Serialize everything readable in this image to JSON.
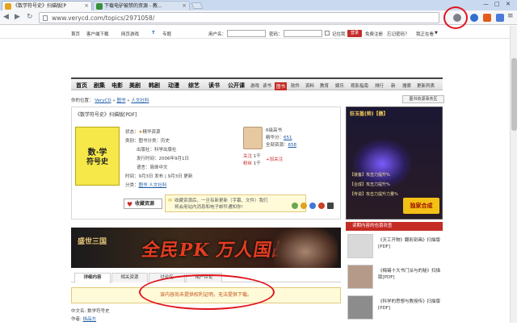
{
  "browser": {
    "tabs": [
      {
        "title": "《数学符号史》扫描版[P",
        "active": true
      },
      {
        "title": "下载电驴被禁的资源 - 教...",
        "active": false
      }
    ],
    "url": "www.verycd.com/topics/2971058/",
    "window_controls": [
      "—",
      "□",
      "✕"
    ]
  },
  "topbar": {
    "links": [
      "首页",
      "客户端下载",
      "网页游戏",
      "T",
      "专题"
    ],
    "username_label": "用户名：",
    "password_label": "密码：",
    "remember": "记住我",
    "login": "登录",
    "register": "免费注册",
    "forgot": "忘记密码？",
    "want": "我正在看"
  },
  "mainnav": {
    "big": [
      "首页",
      "剧集",
      "电影",
      "美剧",
      "韩剧",
      "动漫",
      "综艺",
      "读书",
      "公开课"
    ],
    "small": [
      "游戏",
      "读书",
      "图书",
      "软件",
      "资料",
      "教育",
      "娱乐",
      "观影指南",
      "排行",
      "新",
      "搜索",
      "更新列表"
    ]
  },
  "breadcrumb": {
    "prefix": "你的位置：",
    "items": [
      "VeryCD",
      "图书",
      "人文社科"
    ],
    "sep": "»",
    "top_button": "图书资源事务区"
  },
  "item": {
    "title": "《数学符号史》扫描版[PDF]",
    "cover_title": "数·学",
    "cover_subtitle": "符号史",
    "meta": [
      {
        "k": "状态：",
        "v": "精华资源"
      },
      {
        "k": "类别：",
        "v": "图书分类：历史"
      },
      {
        "k": "",
        "v": "出版社：科学出版社"
      },
      {
        "k": "",
        "v": "发行时间：2006年9月1日"
      },
      {
        "k": "",
        "v": "语言：简体中文"
      },
      {
        "k": "时间：",
        "v": "9月3日 发布 | 9月3日 更新"
      },
      {
        "k": "分类：",
        "v": "图书  人文社科"
      }
    ],
    "uploader": {
      "name": "6级高书",
      "uploads_label": "精华分：",
      "uploads": "651",
      "total_label": "全部资源：",
      "total": "658",
      "follow_label": "关注",
      "follow_count": "1千",
      "fans_label": "粉丝",
      "fans_count": "1千",
      "add_follow": "加关注"
    },
    "favorite_button": "收藏资源",
    "tooltip_line1": "收藏资源后，一旦有新更新（字幕、文件）我们",
    "tooltip_line2": "将会用站内消息和电子邮件通知你!"
  },
  "game_ad": {
    "name": "狂玉盔(帅)",
    "tag": "傲",
    "lines": [
      "【装备】攻击力提升%",
      "【合成】攻击力提升%",
      "【传说】攻击力提升力量%"
    ],
    "button": "独家合成"
  },
  "banner": {
    "logo": "盛世三国",
    "slogan": "全民PK 万人国战"
  },
  "related": {
    "header": "读期内容的也喜欢查",
    "items": [
      {
        "text": "《天工开物》翻彩刻画》扫描版[PDF]",
        "thumb_color": "#d9d9d9"
      },
      {
        "text": "《梅锡十大书门派与的秘》扫描版[PDF]",
        "thumb_color": "#b59a8a"
      },
      {
        "text": "《科学的思想与教授传》扫描版[PDF]",
        "thumb_color": "#8c8c8c"
      }
    ]
  },
  "tabs": [
    "详细内容",
    "相关资源",
    "讨论区",
    "用户评论"
  ],
  "notice": "该内容尚未提供权利证明，无法提供下载。",
  "footer": [
    {
      "k": "中文名: ",
      "v": "数学符号史"
    },
    {
      "k": "作者: ",
      "v": "徐品方"
    }
  ],
  "colors": {
    "accent": "#c52b25",
    "annotation": "#e2141d",
    "link": "#1a5aa6"
  }
}
